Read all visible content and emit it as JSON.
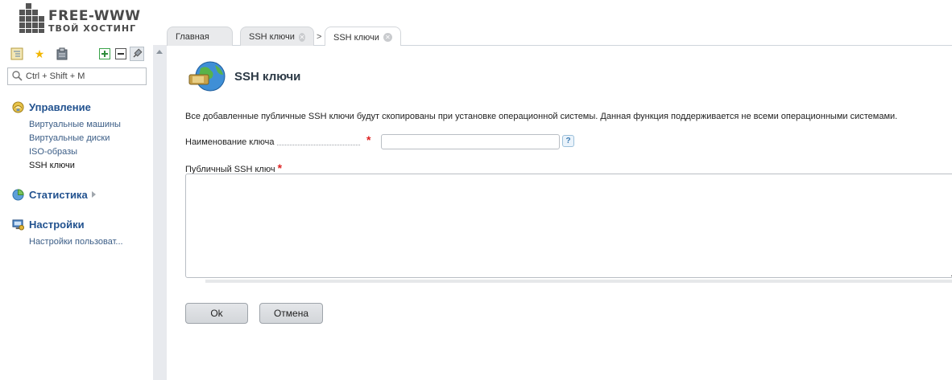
{
  "brand": {
    "name": "FREE-WWW",
    "tagline": "ТВОЙ ХОСТИНГ"
  },
  "tabs": [
    {
      "label": "Главная",
      "closable": false,
      "active": false
    },
    {
      "label": "SSH ключи",
      "closable": true,
      "active": false
    },
    {
      "label": "SSH ключи",
      "closable": true,
      "active": true
    }
  ],
  "tab_separator": ">",
  "sidebar": {
    "search_placeholder": "Ctrl + Shift + M",
    "groups": [
      {
        "title": "Управление",
        "icon": "management-icon",
        "items": [
          "Виртуальные машины",
          "Виртуальные диски",
          "ISO-образы",
          "SSH ключи"
        ],
        "current": "SSH ключи"
      },
      {
        "title": "Статистика",
        "icon": "statistics-icon",
        "items": []
      },
      {
        "title": "Настройки",
        "icon": "settings-icon",
        "items": [
          "Настройки пользоват..."
        ]
      }
    ]
  },
  "page": {
    "title": "SSH ключи",
    "description": "Все добавленные публичные SSH ключи будут скопированы при установке операционной системы. Данная функция поддерживается не всеми операционными системами.",
    "fields": {
      "key_name_label": "Наименование ключа",
      "key_name_value": "",
      "public_key_label": "Публичный SSH ключ",
      "public_key_value": "",
      "required_mark": "*",
      "help_mark": "?"
    },
    "buttons": {
      "ok": "Ok",
      "cancel": "Отмена"
    }
  },
  "colors": {
    "link": "#3b5d86",
    "group_title": "#22528f",
    "required": "#dd2222"
  }
}
